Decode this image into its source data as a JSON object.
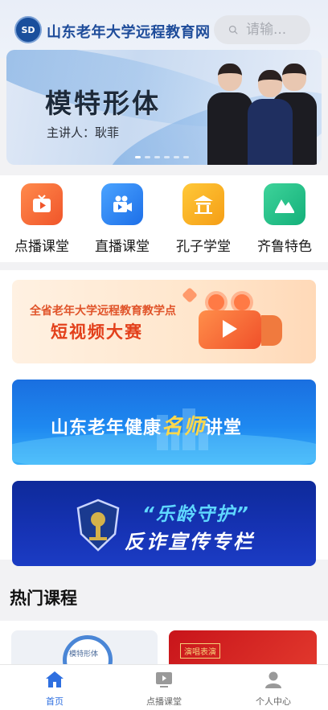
{
  "header": {
    "logo_text": "SD",
    "title": "山东老年大学远程教育网",
    "search_placeholder": "请输..."
  },
  "banner": {
    "title": "模特形体",
    "speaker": "主讲人：耿菲",
    "slide_count": 6,
    "active_slide": 1
  },
  "quick_nav": [
    {
      "label": "点播课堂",
      "icon": "tv-icon",
      "color": "#f0552a"
    },
    {
      "label": "直播课堂",
      "icon": "video-camera-icon",
      "color": "#1d6fe8"
    },
    {
      "label": "孔子学堂",
      "icon": "pavilion-icon",
      "color": "#f59e16"
    },
    {
      "label": "齐鲁特色",
      "icon": "mountain-icon",
      "color": "#14b07a"
    }
  ],
  "promos": [
    {
      "sub": "全省老年大学远程教育教学点",
      "main": "短视频大赛"
    },
    {
      "title_pre": "山东老年健康",
      "title_hl": "名师",
      "title_post": "讲堂"
    },
    {
      "line1": "“乐龄守护”",
      "line2": "反诈宣传专栏"
    }
  ],
  "hot": {
    "title": "热门课程",
    "items": [
      {
        "thumb_text": "模特形体"
      },
      {
        "thumb_text": "演唱表演"
      }
    ]
  },
  "tabbar": [
    {
      "label": "首页",
      "icon": "home-icon",
      "active": true
    },
    {
      "label": "点播课堂",
      "icon": "tv-icon",
      "active": false
    },
    {
      "label": "个人中心",
      "icon": "user-icon",
      "active": false
    }
  ],
  "colors": {
    "brand_blue": "#1e4c9a",
    "tab_active": "#2e6fe0"
  }
}
